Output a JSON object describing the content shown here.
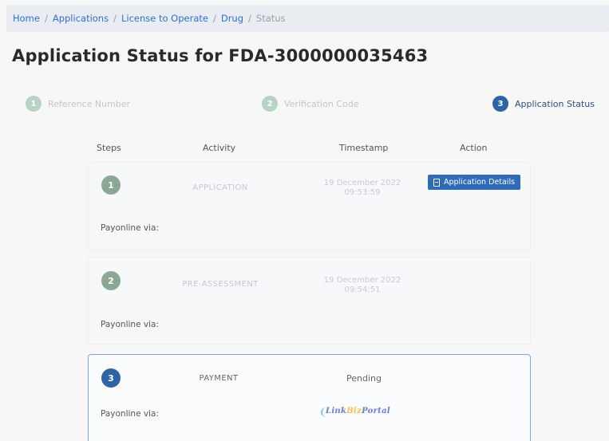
{
  "breadcrumb": {
    "items": [
      "Home",
      "Applications",
      "License to Operate",
      "Drug"
    ],
    "current": "Status",
    "separator": "/"
  },
  "page": {
    "title": "Application Status for FDA-3000000035463"
  },
  "stepper": {
    "steps": [
      {
        "number": "1",
        "label": "Reference Number",
        "state": "done"
      },
      {
        "number": "2",
        "label": "Verification Code",
        "state": "done"
      },
      {
        "number": "3",
        "label": "Application Status",
        "state": "active"
      }
    ]
  },
  "table": {
    "headers": {
      "steps": "Steps",
      "activity": "Activity",
      "timestamp": "Timestamp",
      "action": "Action"
    },
    "rows": [
      {
        "step": "1",
        "activity": "APPLICATION",
        "timestamp_date": "19 December 2022",
        "timestamp_time": "09:53:59",
        "action_label": "Application Details",
        "action_icon": "document-icon",
        "payonline_label": "Payonline via:"
      },
      {
        "step": "2",
        "activity": "PRE-ASSESSMENT",
        "timestamp_date": "19 December 2022",
        "timestamp_time": "09:54:51",
        "payonline_label": "Payonline via:"
      },
      {
        "step": "3",
        "activity": "PAYMENT",
        "timestamp_status": "Pending",
        "payonline_label": "Payonline via:",
        "payment_logo": {
          "part1": "Link",
          "part2": "Biz",
          "part3": "Portal"
        }
      }
    ]
  },
  "colors": {
    "accent": "#2f63a8",
    "done_step": "#b7d3c3",
    "highlight_border": "#7ea6dc"
  }
}
